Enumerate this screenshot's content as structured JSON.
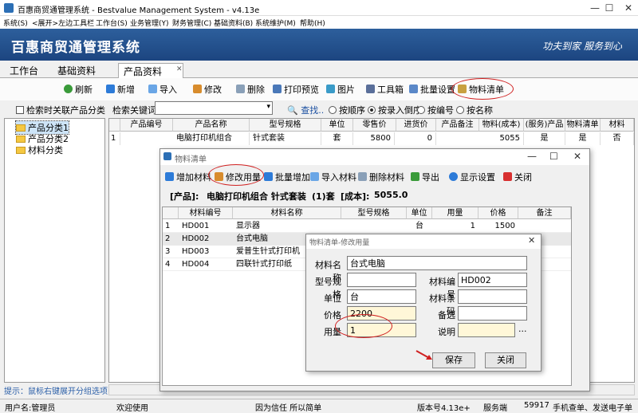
{
  "window": {
    "title": "百惠商贸通管理系统 - Bestvalue Management System - v4.13e",
    "min": "—",
    "max": "☐",
    "close": "✕"
  },
  "menu": [
    "系统(S)",
    "<展开>左边工具栏",
    "工作台(S)",
    "业务管理(Y)",
    "财务管理(C)",
    "基础资料(B)",
    "系统维护(M)",
    "帮助(H)"
  ],
  "banner": {
    "title": "百惠商贸通管理系统",
    "slogan": "功夫到家 服务到心"
  },
  "tabs": {
    "t1": "工作台",
    "t2": "基础资料",
    "t3": "产品资料",
    "close": "✕"
  },
  "toolbar": {
    "refresh": "刷新",
    "add": "新增",
    "import": "导入",
    "edit": "修改",
    "delete": "删除",
    "print": "打印预览",
    "image": "图片",
    "tools": "工具箱",
    "batch": "批量设置",
    "bom": "物料清单"
  },
  "search": {
    "related": "检索时关联产品分类",
    "keyword_label": "检索关键词",
    "find": "查找..",
    "sort_order": "按顺序",
    "sort_entry": "按录入倒序",
    "sort_code": "按编号",
    "sort_name": "按名称"
  },
  "tree": [
    "产品分类1",
    "产品分类2",
    "材料分类"
  ],
  "grid": {
    "headers": [
      "产品编号",
      "产品名称",
      "型号规格",
      "单位",
      "零售价",
      "进货价",
      "产品备注",
      "物料(成本)",
      "(服务)产品",
      "物料清单",
      "材料"
    ],
    "row": {
      "n": "1",
      "name": "电脑打印机组合",
      "spec": "针式套装",
      "unit": "套",
      "retail": "5800",
      "purchase": "0",
      "cost": "5055",
      "service": "是",
      "bom": "是",
      "material": "否"
    }
  },
  "hint": "提示：鼠标右键展开分组选项",
  "status": {
    "user": "用户名:管理员",
    "welcome": "欢迎使用",
    "motto": "因为信任 所以简单",
    "version": "版本号4.13e+",
    "server": "服务端",
    "port": "59917",
    "phone": "手机查单、发送电子单"
  },
  "bom_window": {
    "title": "物料清单",
    "toolbar": {
      "add": "增加材料",
      "edit_qty": "修改用量",
      "batch_add": "批量增加",
      "import": "导入材料",
      "delete": "删除材料",
      "export": "导出",
      "display": "显示设置",
      "close": "关闭"
    },
    "info": {
      "product_label": "[产品]:",
      "product": "电脑打印机组合 针式套装",
      "qty": "(1)套",
      "cost_label": "[成本]:",
      "cost": "5055.0"
    },
    "headers": [
      "材料编号",
      "材料名称",
      "型号规格",
      "单位",
      "用量",
      "价格",
      "备注"
    ],
    "rows": [
      {
        "n": "1",
        "code": "HD001",
        "name": "显示器",
        "unit": "台",
        "qty": "1",
        "price": "1500"
      },
      {
        "n": "2",
        "code": "HD002",
        "name": "台式电脑",
        "unit": "台",
        "qty": "",
        "price": ""
      },
      {
        "n": "3",
        "code": "HD003",
        "name": "爱普生针式打印机",
        "unit": "",
        "qty": "",
        "price": ""
      },
      {
        "n": "4",
        "code": "HD004",
        "name": "四联针式打印纸",
        "unit": "",
        "qty": "",
        "price": ""
      }
    ]
  },
  "dialog": {
    "title": "物料清单-修改用量",
    "labels": {
      "name": "材料名称",
      "code": "材料编号",
      "spec": "型号规格",
      "unit": "单位",
      "barcode": "材料条码",
      "price": "价格",
      "select": "备选",
      "qty": "用量",
      "note": "说明"
    },
    "values": {
      "name": "台式电脑",
      "code": "HD002",
      "spec": "",
      "unit": "台",
      "barcode": "",
      "price": "2200",
      "select": "",
      "qty": "1",
      "note": ""
    },
    "more": "...",
    "save": "保存",
    "close": "关闭"
  }
}
